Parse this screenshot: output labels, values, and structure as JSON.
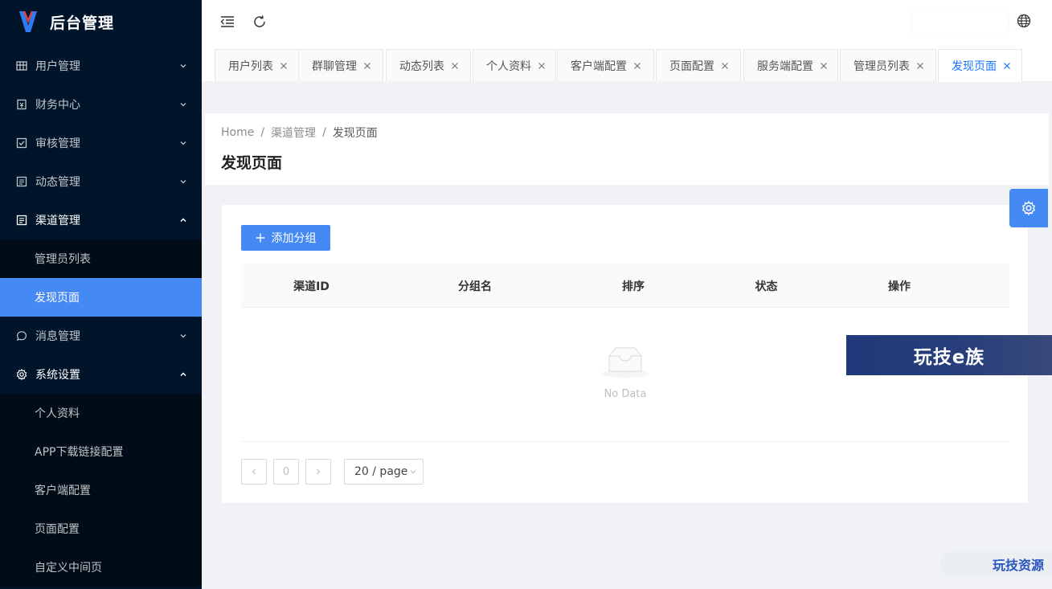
{
  "app": {
    "title": "后台管理"
  },
  "sidebar": {
    "items": [
      {
        "label": "用户管理",
        "icon": "table-icon",
        "expanded": false
      },
      {
        "label": "财务中心",
        "icon": "wallet-icon",
        "expanded": false
      },
      {
        "label": "审核管理",
        "icon": "check-square-icon",
        "expanded": false
      },
      {
        "label": "动态管理",
        "icon": "file-text-icon",
        "expanded": false
      },
      {
        "label": "渠道管理",
        "icon": "file-text-icon",
        "expanded": true,
        "children": [
          {
            "label": "管理员列表",
            "active": false
          },
          {
            "label": "发现页面",
            "active": true
          }
        ]
      },
      {
        "label": "消息管理",
        "icon": "message-icon",
        "expanded": false
      },
      {
        "label": "系统设置",
        "icon": "gear-icon",
        "expanded": true,
        "children": [
          {
            "label": "个人资料"
          },
          {
            "label": "APP下载链接配置"
          },
          {
            "label": "客户端配置"
          },
          {
            "label": "页面配置"
          },
          {
            "label": "自定义中间页"
          }
        ]
      }
    ]
  },
  "tabs": [
    {
      "label": "用户列表",
      "active": false
    },
    {
      "label": "群聊管理",
      "active": false
    },
    {
      "label": "动态列表",
      "active": false
    },
    {
      "label": "个人资料",
      "active": false
    },
    {
      "label": "客户端配置",
      "active": false
    },
    {
      "label": "页面配置",
      "active": false
    },
    {
      "label": "服务端配置",
      "active": false
    },
    {
      "label": "管理员列表",
      "active": false
    },
    {
      "label": "发现页面",
      "active": true
    }
  ],
  "breadcrumb": {
    "items": [
      "Home",
      "渠道管理",
      "发现页面"
    ],
    "separator": "/"
  },
  "page": {
    "title": "发现页面"
  },
  "toolbar": {
    "add_label": "添加分组"
  },
  "table": {
    "columns": [
      "渠道ID",
      "分组名",
      "排序",
      "状态",
      "操作"
    ],
    "rows": [],
    "empty_text": "No Data"
  },
  "pagination": {
    "current": "0",
    "page_size": "20 / page"
  },
  "watermarks": {
    "banner": "玩技e族",
    "corner": "玩技资源"
  },
  "colors": {
    "primary": "#4589f5",
    "sidebar_bg": "#001529",
    "active_tab": "#1677ff"
  }
}
